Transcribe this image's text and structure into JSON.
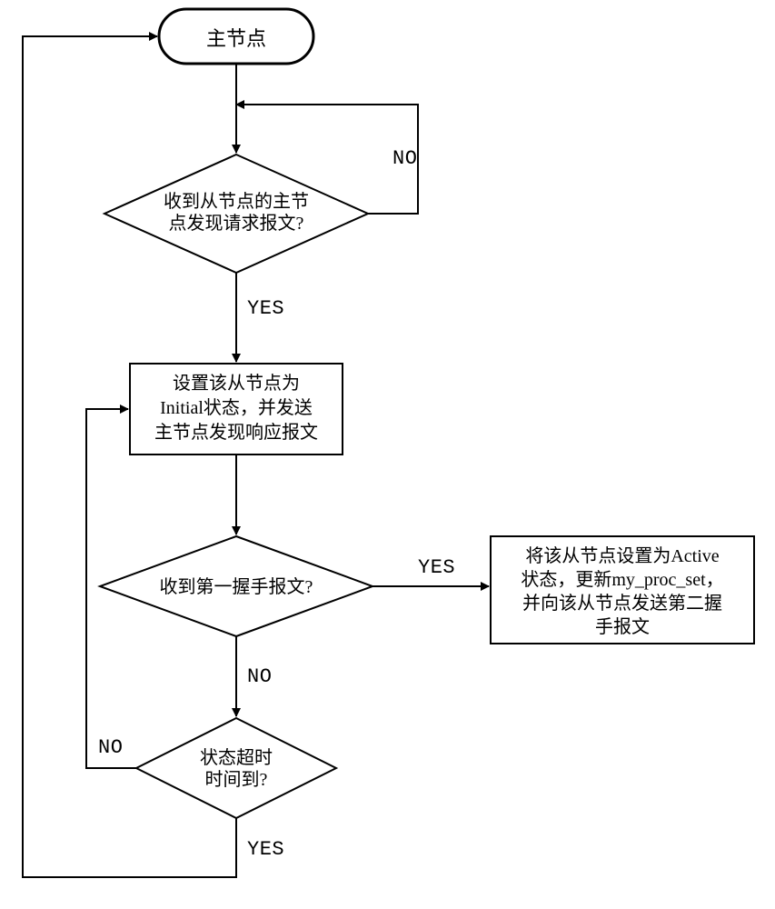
{
  "flow": {
    "start": "主节点",
    "dec1_l1": "收到从节点的主节",
    "dec1_l2": "点发现请求报文?",
    "dec1_no": "NO",
    "dec1_yes": "YES",
    "proc1_l1": "设置该从节点为",
    "proc1_l2": "Initial状态，并发送",
    "proc1_l3": "主节点发现响应报文",
    "dec2": "收到第一握手报文?",
    "dec2_yes": "YES",
    "dec2_no": "NO",
    "proc2_l1": "将该从节点设置为Active",
    "proc2_l2": "状态，更新my_proc_set，",
    "proc2_l3": "并向该从节点发送第二握",
    "proc2_l4": "手报文",
    "dec3_l1": "状态超时",
    "dec3_l2": "时间到?",
    "dec3_no": "NO",
    "dec3_yes": "YES"
  }
}
